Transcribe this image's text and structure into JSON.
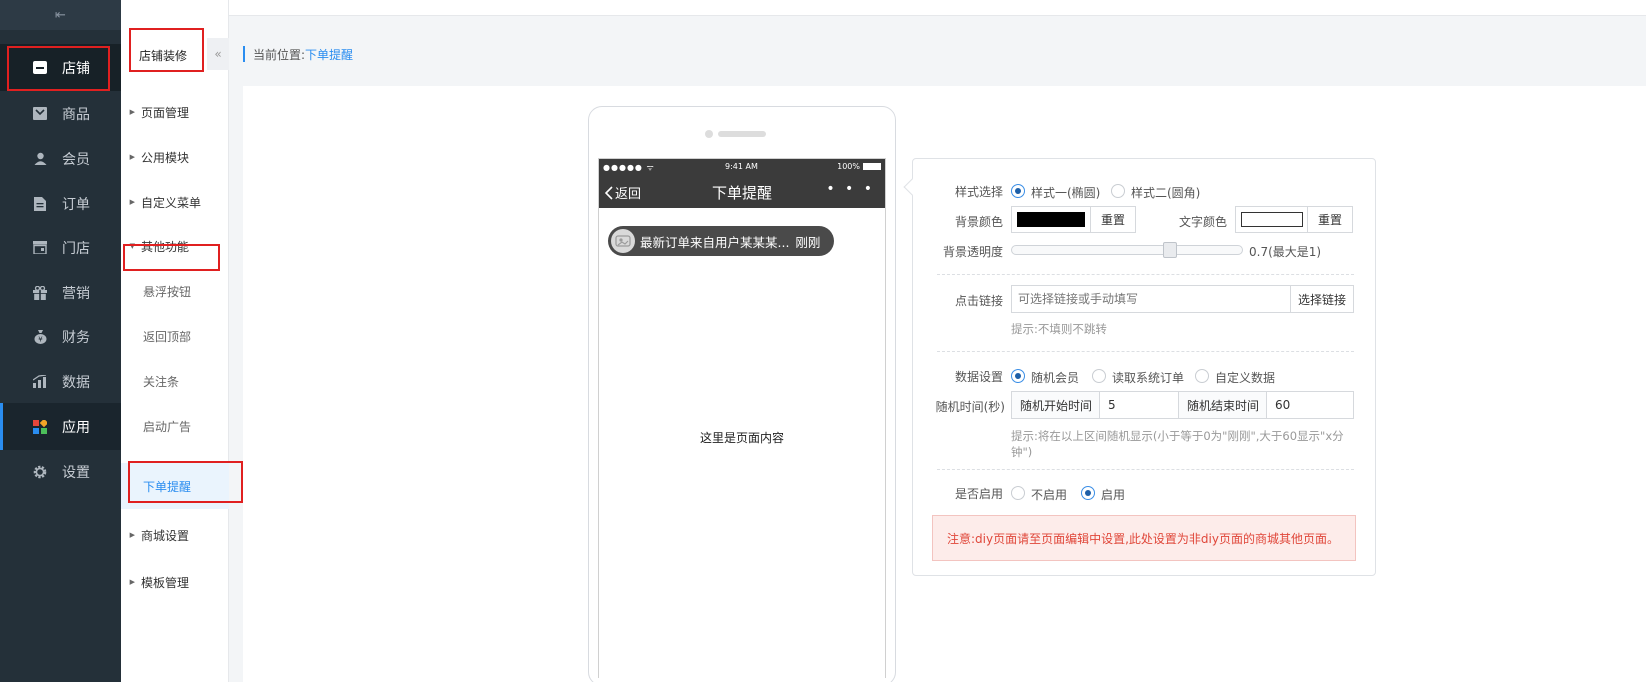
{
  "sidebar": {
    "collapse_glyph": "⇤",
    "items": [
      {
        "label": "店铺",
        "icon": "store-icon"
      },
      {
        "label": "商品",
        "icon": "goods-icon"
      },
      {
        "label": "会员",
        "icon": "member-icon"
      },
      {
        "label": "订单",
        "icon": "order-icon"
      },
      {
        "label": "门店",
        "icon": "shop-icon"
      },
      {
        "label": "营销",
        "icon": "gift-icon"
      },
      {
        "label": "财务",
        "icon": "finance-icon"
      },
      {
        "label": "数据",
        "icon": "chart-icon"
      },
      {
        "label": "应用",
        "icon": "apps-icon"
      },
      {
        "label": "设置",
        "icon": "gear-icon"
      }
    ]
  },
  "subnav": {
    "title": "店铺装修",
    "fold_glyph": "«",
    "items": [
      {
        "label": "页面管理"
      },
      {
        "label": "公用模块"
      },
      {
        "label": "自定义菜单"
      },
      {
        "label": "其他功能"
      },
      {
        "label": "悬浮按钮"
      },
      {
        "label": "返回顶部"
      },
      {
        "label": "关注条"
      },
      {
        "label": "启动广告"
      },
      {
        "label": "下单提醒"
      },
      {
        "label": "商城设置"
      },
      {
        "label": "模板管理"
      }
    ]
  },
  "breadcrumb": {
    "prefix": "当前位置:",
    "current": "下单提醒"
  },
  "phone": {
    "status_left": "●●●●● ᯤ",
    "status_time": "9:41 AM",
    "status_battery": "100%",
    "back_label": "返回",
    "title": "下单提醒",
    "more": "• • •",
    "notice_message": "最新订单来自用户某某某...",
    "notice_time": "刚刚",
    "page_content": "这里是页面内容"
  },
  "form": {
    "style_label": "样式选择",
    "style_opt1": "样式一(椭圆)",
    "style_opt2": "样式二(圆角)",
    "bg_color_label": "背景颜色",
    "bg_color_value": "#000000",
    "reset_label": "重置",
    "text_color_label": "文字颜色",
    "text_color_value": "#ffffff",
    "opacity_label": "背景透明度",
    "opacity_value": 0.7,
    "opacity_text": "0.7(最大是1)",
    "link_label": "点击链接",
    "link_placeholder": "可选择链接或手动填写",
    "link_button": "选择链接",
    "link_hint": "提示:不填则不跳转",
    "data_label": "数据设置",
    "data_opt1": "随机会员",
    "data_opt2": "读取系统订单",
    "data_opt3": "自定义数据",
    "random_time_label": "随机时间(秒)",
    "start_label": "随机开始时间",
    "start_value": "5",
    "end_label": "随机结束时间",
    "end_value": "60",
    "random_hint": "提示:将在以上区间随机显示(小于等于0为\"刚刚\",大于60显示\"x分钟\")",
    "enable_label": "是否启用",
    "enable_off": "不启用",
    "enable_on": "启用",
    "warning": "注意:diy页面请至页面编辑中设置,此处设置为非diy页面的商城其他页面。"
  },
  "colors": {
    "accent": "#2a8df0",
    "sidebar_bg": "#243039",
    "warning_text": "#e0473a",
    "annotation": "#e02020"
  }
}
